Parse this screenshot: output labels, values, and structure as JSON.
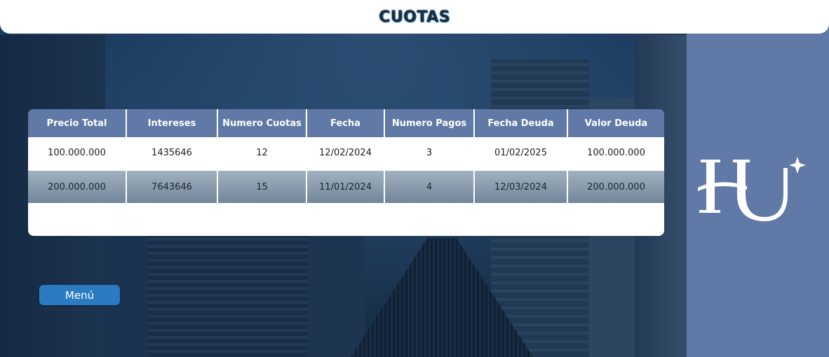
{
  "header": {
    "title": "CUOTAS"
  },
  "table": {
    "columns": [
      "Precio Total",
      "Intereses",
      "Numero Cuotas",
      "Fecha",
      "Numero Pagos",
      "Fecha Deuda",
      "Valor Deuda"
    ],
    "rows": [
      [
        "100.000.000",
        "1435646",
        "12",
        "12/02/2024",
        "3",
        "01/02/2025",
        "100.000.000"
      ],
      [
        "200.000.000",
        "7643646",
        "15",
        "11/01/2024",
        "4",
        "12/03/2024",
        "200.000.000"
      ]
    ]
  },
  "menu": {
    "label": "Menú"
  },
  "colors": {
    "header_bg": "#ffffff",
    "panel": "#6079a6",
    "button": "#2a7bc2"
  },
  "icons": {
    "logo": "hu-logo-icon"
  }
}
